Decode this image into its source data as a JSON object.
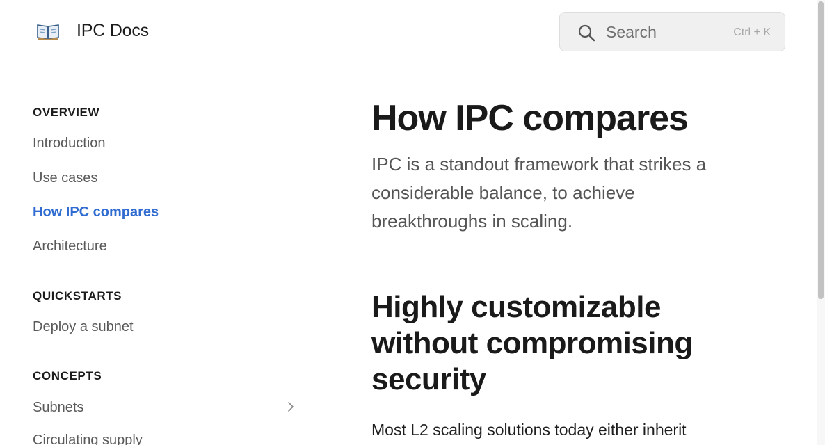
{
  "header": {
    "brand": "IPC Docs",
    "search": {
      "placeholder": "Search",
      "shortcut": "Ctrl + K"
    }
  },
  "sidebar": {
    "sections": [
      {
        "title": "OVERVIEW",
        "items": [
          {
            "label": "Introduction"
          },
          {
            "label": "Use cases"
          },
          {
            "label": "How IPC compares",
            "active": true
          },
          {
            "label": "Architecture"
          }
        ]
      },
      {
        "title": "QUICKSTARTS",
        "items": [
          {
            "label": "Deploy a subnet"
          }
        ]
      },
      {
        "title": "CONCEPTS",
        "items": [
          {
            "label": "Subnets"
          },
          {
            "label": "Circulating supply"
          }
        ]
      }
    ]
  },
  "main": {
    "title": "How IPC compares",
    "lead": "IPC is a standout framework that strikes a considerable balance, to achieve breakthroughs in scaling.",
    "section_heading": "Highly customizable without compromising security",
    "paragraph_start": "Most L2 scaling solutions today either inherit"
  },
  "colors": {
    "accent": "#2f6bd0",
    "text": "#1a1a1a",
    "muted": "#5a5a5a"
  }
}
